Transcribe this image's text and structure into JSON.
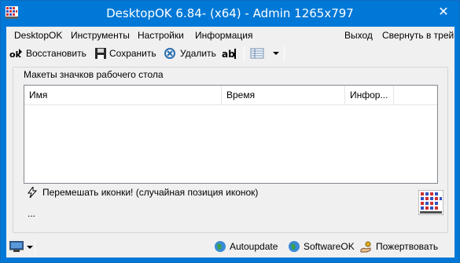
{
  "window": {
    "title": "DesktopOK 6.84- (x64) - Admin 1265x797",
    "close_glyph": "✕"
  },
  "menu": {
    "items": [
      "DesktopOK",
      "Инструменты",
      "Настройки",
      "Информация"
    ],
    "exit": "Выход",
    "minimize_tray": "Свернуть в трей"
  },
  "toolbar": {
    "restore": "Восстановить",
    "save": "Сохранить",
    "delete": "Удалить"
  },
  "group": {
    "label": "Макеты значков рабочего стола",
    "columns": [
      "Имя",
      "Время",
      "Инфор..."
    ]
  },
  "shuffle_text": "Перемешать иконки! (случайная позиция иконок)",
  "dots": "...",
  "statusbar": {
    "autoupdate": "Autoupdate",
    "softwareok": "SoftwareOK",
    "donate": "Пожертвовать"
  }
}
